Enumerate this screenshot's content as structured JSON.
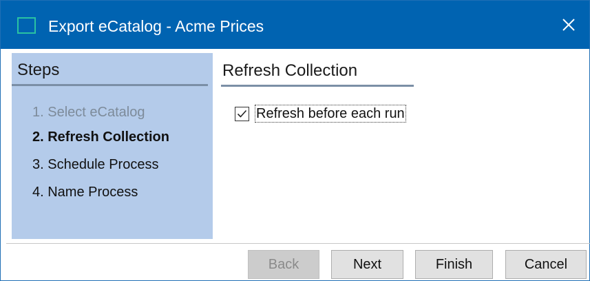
{
  "window": {
    "title": "Export eCatalog - Acme Prices",
    "close_icon": "close-icon"
  },
  "steps": {
    "heading": "Steps",
    "items": [
      {
        "label": "1. Select eCatalog",
        "state": "completed"
      },
      {
        "label": "2. Refresh Collection",
        "state": "current"
      },
      {
        "label": "3. Schedule Process",
        "state": "pending"
      },
      {
        "label": "4. Name Process",
        "state": "pending"
      }
    ]
  },
  "content": {
    "heading": "Refresh Collection",
    "refresh_checkbox": {
      "label": "Refresh before each run",
      "checked": true
    }
  },
  "buttons": {
    "back": "Back",
    "next": "Next",
    "finish": "Finish",
    "cancel": "Cancel"
  },
  "colors": {
    "titlebar": "#0063b1",
    "steps_panel": "#b4cbea",
    "accent_icon": "#2ac3a2"
  }
}
